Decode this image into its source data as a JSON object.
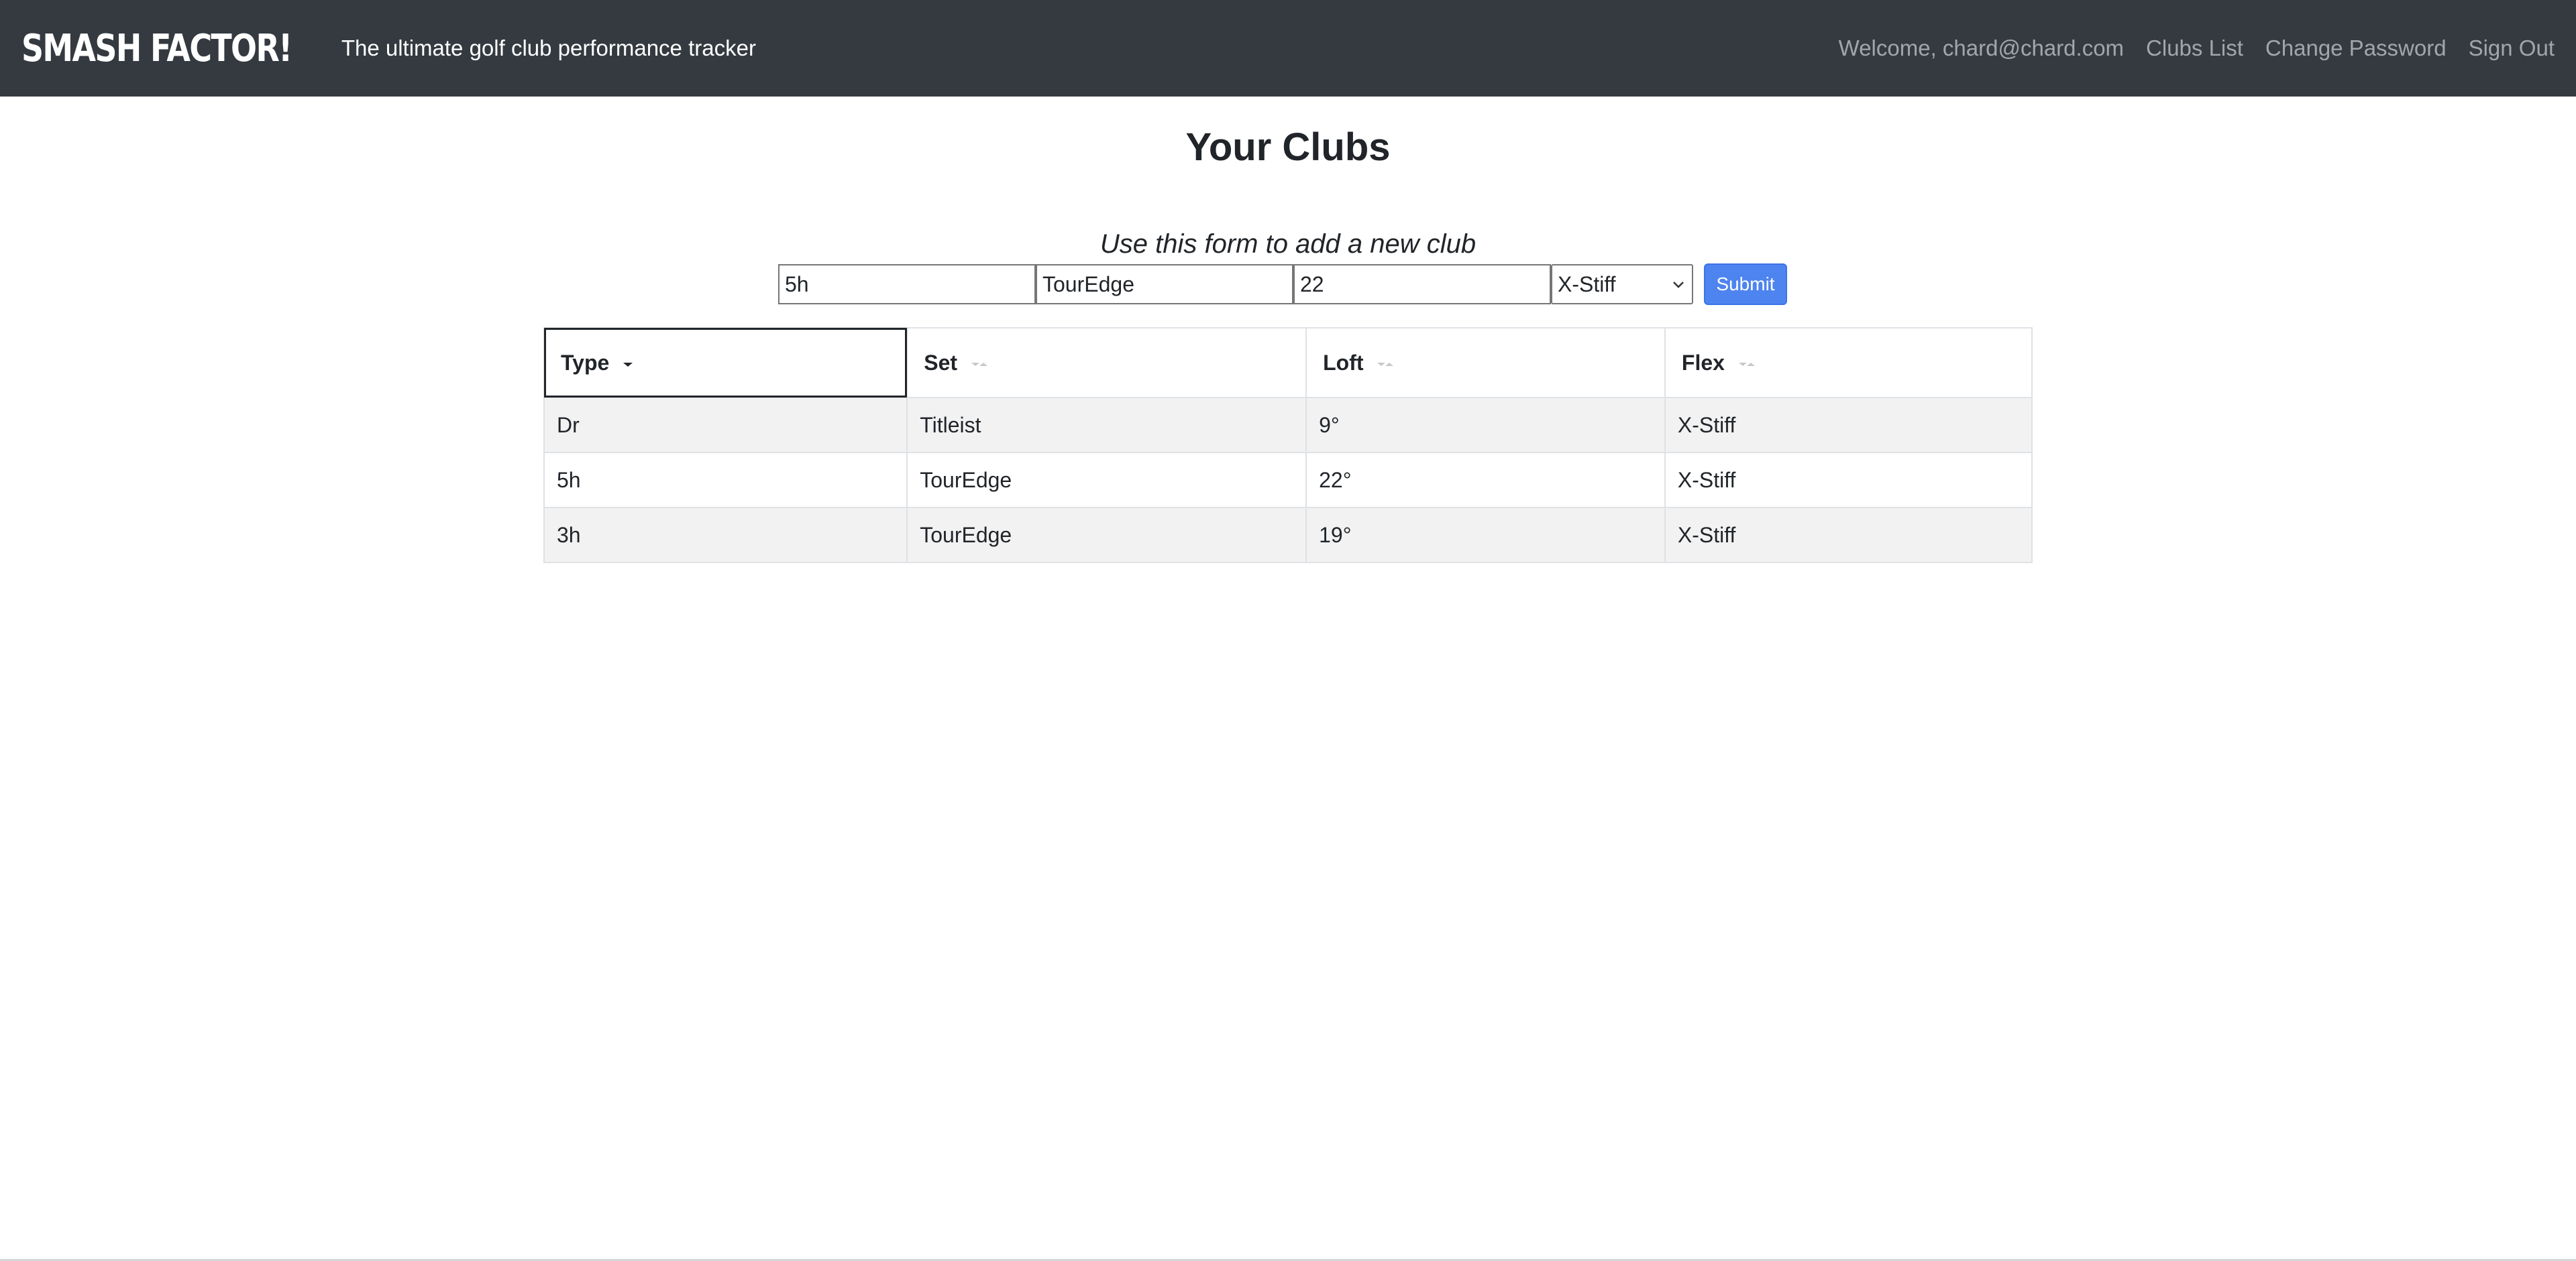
{
  "navbar": {
    "brand": "SMASH FACTOR!",
    "tagline": "The ultimate golf club performance tracker",
    "welcome": "Welcome, chard@chard.com",
    "links": [
      "Clubs List",
      "Change Password",
      "Sign Out"
    ]
  },
  "page": {
    "title": "Your Clubs"
  },
  "form": {
    "caption": "Use this form to add a new club",
    "type_value": "5h",
    "set_value": "TourEdge",
    "loft_value": "22",
    "flex_selected": "X-Stiff",
    "submit_label": "Submit"
  },
  "table": {
    "columns": [
      "Type",
      "Set",
      "Loft",
      "Flex"
    ],
    "sorted_column": "Type",
    "rows": [
      [
        "Dr",
        "Titleist",
        "9°",
        "X-Stiff"
      ],
      [
        "5h",
        "TourEdge",
        "22°",
        "X-Stiff"
      ],
      [
        "3h",
        "TourEdge",
        "19°",
        "X-Stiff"
      ]
    ]
  },
  "colors": {
    "navbar": "#343a40",
    "accent": "#4e84f0",
    "stripe": "#f2f2f2"
  }
}
